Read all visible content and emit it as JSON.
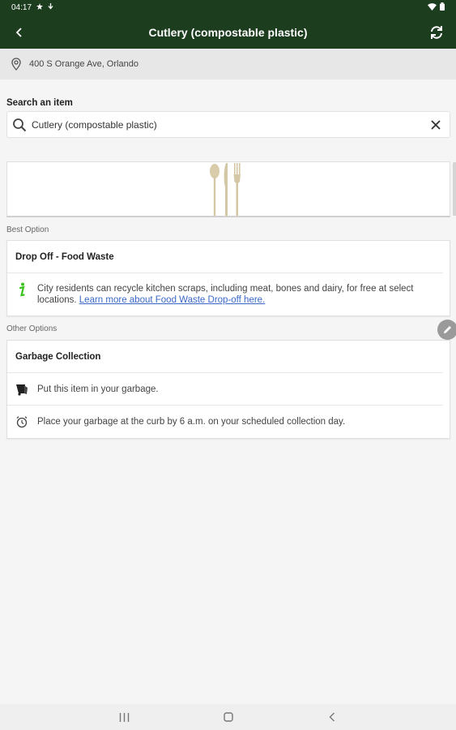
{
  "status": {
    "time": "04:17"
  },
  "app_bar": {
    "title": "Cutlery (compostable plastic)"
  },
  "address": {
    "text": "400 S Orange Ave, Orlando"
  },
  "search": {
    "label": "Search an item",
    "value": "Cutlery (compostable plastic)"
  },
  "best_option": {
    "section_label": "Best Option",
    "title": "Drop Off - Food Waste",
    "info_text": "City residents can recycle kitchen scraps, including meat, bones and dairy, for free at select locations. ",
    "info_link": "Learn more about Food Waste Drop-off here."
  },
  "other_options": {
    "section_label": "Other Options",
    "title": "Garbage Collection",
    "rows": [
      {
        "icon": "garbage-bin-icon",
        "text": "Put this item in your garbage."
      },
      {
        "icon": "alarm-clock-icon",
        "text": "Place your garbage at the curb by 6 a.m. on your scheduled collection day."
      }
    ]
  },
  "colors": {
    "header": "#1d3d1f",
    "info_icon": "#3cc21f",
    "link": "#3a67c7"
  }
}
